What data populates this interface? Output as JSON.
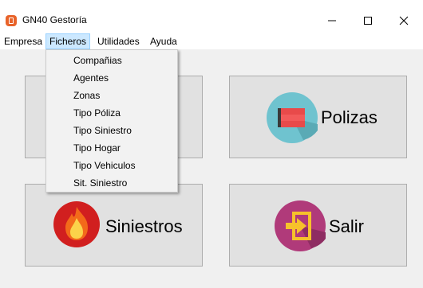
{
  "window": {
    "title": "GN40 Gestoría"
  },
  "menubar": {
    "items": [
      {
        "label": "Empresa"
      },
      {
        "label": "Ficheros",
        "active": true
      },
      {
        "label": "Utilidades"
      },
      {
        "label": "Ayuda"
      }
    ]
  },
  "dropdown": {
    "items": [
      {
        "label": "Compañias"
      },
      {
        "label": "Agentes"
      },
      {
        "label": "Zonas"
      },
      {
        "label": "Tipo Póliza"
      },
      {
        "label": "Tipo Siniestro"
      },
      {
        "label": "Tipo Hogar"
      },
      {
        "label": "Tipo Vehiculos"
      },
      {
        "label": "Sit. Siniestro"
      }
    ]
  },
  "tiles": {
    "polizas": {
      "label": "Polizas",
      "icon": "document-stack-icon"
    },
    "siniestros": {
      "label": "Siniestros",
      "icon": "fire-icon"
    },
    "salir": {
      "label": "Salir",
      "icon": "exit-door-icon"
    }
  },
  "colors": {
    "active_menu_bg": "#cce8ff",
    "polizas_circle": "#6fc3cf",
    "siniestros_circle": "#d11f1f",
    "salir_circle": "#b03a7a"
  }
}
